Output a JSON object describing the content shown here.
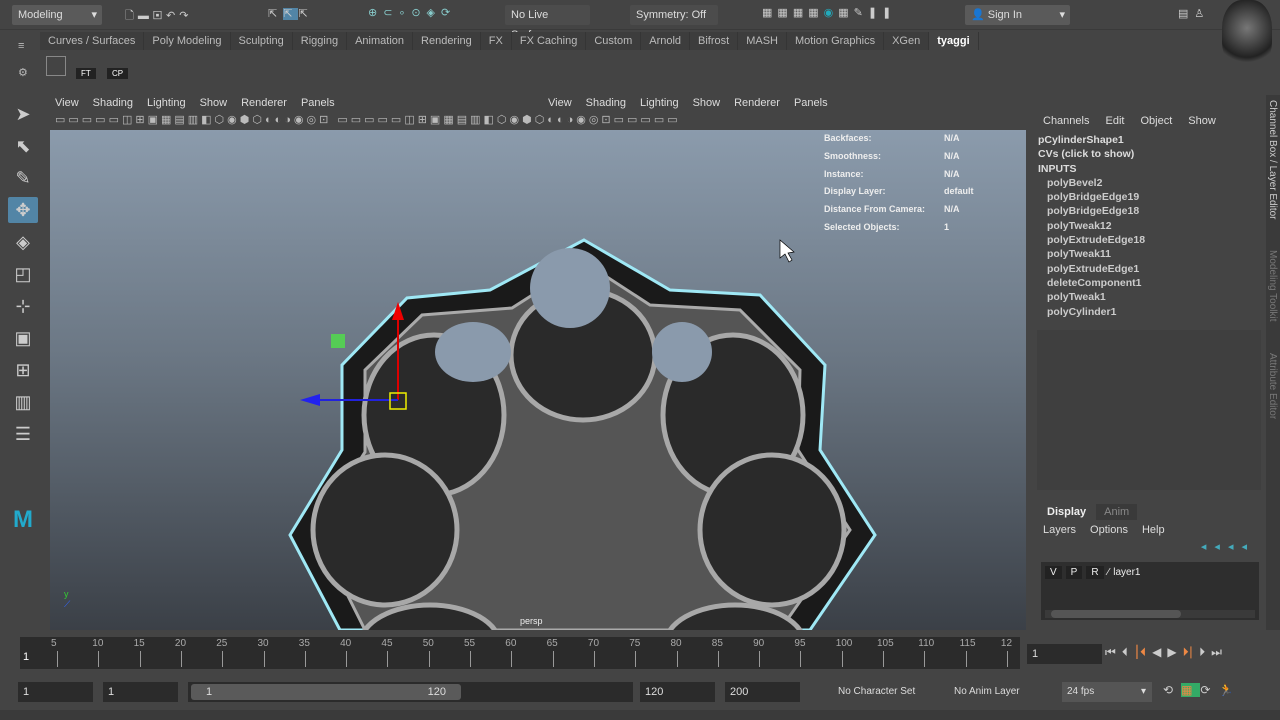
{
  "topbar": {
    "menuset": "Modeling",
    "live_surface": "No Live Surface",
    "symmetry": "Symmetry: Off",
    "sign_in": "Sign In"
  },
  "shelf_tabs": [
    "Curves / Surfaces",
    "Poly Modeling",
    "Sculpting",
    "Rigging",
    "Animation",
    "Rendering",
    "FX",
    "FX Caching",
    "Custom",
    "Arnold",
    "Bifrost",
    "MASH",
    "Motion Graphics",
    "XGen",
    "tyaggi"
  ],
  "shelf_active": "tyaggi",
  "shelf_buttons": [
    "FT",
    "CP"
  ],
  "viewport_menu": [
    "View",
    "Shading",
    "Lighting",
    "Show",
    "Renderer",
    "Panels"
  ],
  "viewport_menu2": [
    "View",
    "Shading",
    "Lighting",
    "Show",
    "Renderer",
    "Panels"
  ],
  "hud": [
    [
      "Backfaces:",
      "N/A"
    ],
    [
      "Smoothness:",
      "N/A"
    ],
    [
      "Instance:",
      "N/A"
    ],
    [
      "Display Layer:",
      "default"
    ],
    [
      "Distance From Camera:",
      "N/A"
    ],
    [
      "Selected Objects:",
      "1"
    ]
  ],
  "camera_label": "persp",
  "channel_box": {
    "menu": [
      "Channels",
      "Edit",
      "Object",
      "Show"
    ],
    "shape": "pCylinderShape1",
    "cvs": "CVs (click to show)",
    "inputs_label": "INPUTS",
    "inputs": [
      "polyBevel2",
      "polyBridgeEdge19",
      "polyBridgeEdge18",
      "polyTweak12",
      "polyExtrudeEdge18",
      "polyTweak11",
      "polyExtrudeEdge1",
      "deleteComponent1",
      "polyTweak1",
      "polyCylinder1"
    ]
  },
  "layer_editor": {
    "tabs": [
      "Display",
      "Anim"
    ],
    "menu": [
      "Layers",
      "Options",
      "Help"
    ],
    "layer": {
      "v": "V",
      "p": "P",
      "r": "R",
      "name": "layer1"
    }
  },
  "side_tabs": [
    "Channel Box / Layer Editor",
    "Modeling Toolkit",
    "Attribute Editor"
  ],
  "timeline": {
    "ticks": [
      "5",
      "10",
      "15",
      "20",
      "25",
      "30",
      "35",
      "40",
      "45",
      "50",
      "55",
      "60",
      "65",
      "70",
      "75",
      "80",
      "85",
      "90",
      "95",
      "100",
      "105",
      "110",
      "115",
      "12"
    ],
    "current_frame": "1",
    "current_field": "1"
  },
  "range": {
    "start": "1",
    "anim_start": "1",
    "slider_start": "1",
    "slider_end": "120",
    "end": "120",
    "anim_end": "200",
    "character_set": "No Character Set",
    "anim_layer": "No Anim Layer",
    "fps": "24 fps"
  }
}
